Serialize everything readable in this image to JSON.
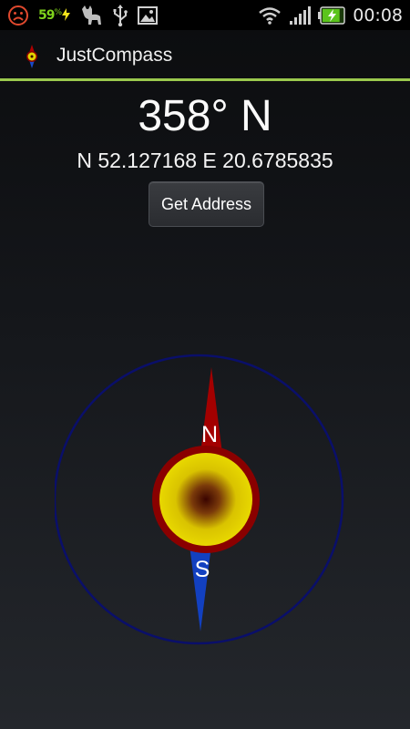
{
  "status_bar": {
    "battery_percent": "59",
    "battery_suffix": "%",
    "time": "00:08",
    "left_icons": [
      "sad-face-icon",
      "lightning-icon",
      "cat-icon",
      "usb-icon",
      "image-icon"
    ],
    "right_icons": [
      "wifi-icon",
      "signal-icon",
      "battery-icon"
    ],
    "battery_level": 0.59
  },
  "app_bar": {
    "title": "JustCompass",
    "accent_color": "#9bc94e"
  },
  "main": {
    "heading": "358° N",
    "coordinates": "N 52.127168 E 20.6785835",
    "get_address_label": "Get Address"
  },
  "compass": {
    "heading_degrees": 358,
    "north_label": "N",
    "south_label": "S",
    "ring_color": "#0a0f6a",
    "north_color": "#a00000",
    "south_color": "#1240c0",
    "hub_color": "#e2d500"
  }
}
